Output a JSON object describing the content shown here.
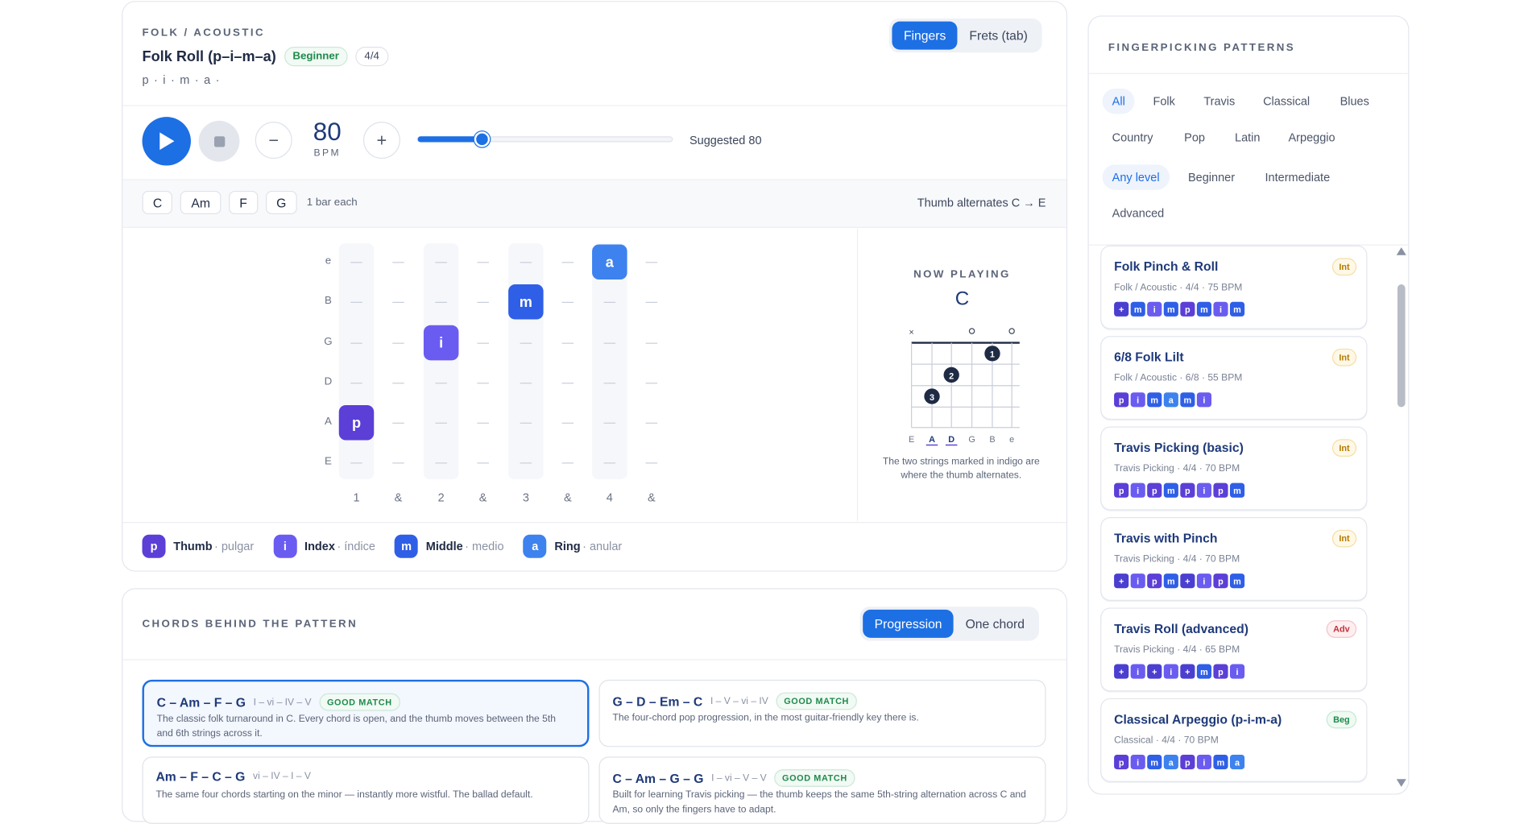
{
  "pattern": {
    "genre": "FOLK / ACOUSTIC",
    "name": "Folk Roll (p–i–m–a)",
    "level": "Beginner",
    "meter": "4/4",
    "sequence": "p · i · m · a ·",
    "view_toggle": [
      "Fingers",
      "Frets (tab)"
    ],
    "view_selected": "Fingers"
  },
  "transport": {
    "bpm": "80",
    "bpm_unit": "BPM",
    "tempo_slider": {
      "min": 40,
      "max": 200,
      "value": 80
    },
    "suggested": "Suggested 80",
    "minus": "−",
    "plus": "+"
  },
  "chords": {
    "items": [
      "C",
      "Am",
      "F",
      "G"
    ],
    "duration": "1 bar each",
    "note": "Thumb alternates C → E"
  },
  "grid": {
    "strings": [
      "e",
      "B",
      "G",
      "D",
      "A",
      "E"
    ],
    "beats": [
      "1",
      "&",
      "2",
      "&",
      "3",
      "&",
      "4",
      "&"
    ],
    "notes": [
      {
        "step": 1,
        "string": "A",
        "finger": "p"
      },
      {
        "step": 3,
        "string": "G",
        "finger": "i"
      },
      {
        "step": 5,
        "string": "B",
        "finger": "m"
      },
      {
        "step": 7,
        "string": "e",
        "finger": "a"
      }
    ]
  },
  "now_playing": {
    "label": "NOW PLAYING",
    "chord": "C",
    "markers": [
      "×",
      "",
      "",
      "○",
      "",
      "○"
    ],
    "dots": [
      "1",
      "2",
      "3"
    ],
    "string_labels": [
      "E",
      "A",
      "D",
      "G",
      "B",
      "e"
    ],
    "caption": "The two strings marked in indigo are where the thumb alternates."
  },
  "legend": [
    {
      "key": "p",
      "name": "Thumb",
      "alt": "· pulgar"
    },
    {
      "key": "i",
      "name": "Index",
      "alt": "· índice"
    },
    {
      "key": "m",
      "name": "Middle",
      "alt": "· medio"
    },
    {
      "key": "a",
      "name": "Ring",
      "alt": "· anular"
    }
  ],
  "colors": {
    "p": "#5b3fd6",
    "i": "#6a5cf0",
    "m": "#2f5fe6",
    "a": "#3d82ee",
    "accent": "#1d6fe4"
  },
  "progressions": {
    "title": "CHORDS BEHIND THE PATTERN",
    "toggle": [
      "Progression",
      "One chord"
    ],
    "items": [
      {
        "chords": "C – Am – F – G",
        "roman": "I – vi – IV – V",
        "badge": "GOOD MATCH",
        "desc": "The classic folk turnaround in C. Every chord is open, and the thumb moves between the 5th and 6th strings across it."
      },
      {
        "chords": "G – D – Em – C",
        "roman": "I – V – vi – IV",
        "badge": "GOOD MATCH",
        "desc": "The four-chord pop progression, in the most guitar-friendly key there is."
      },
      {
        "chords": "Am – F – C – G",
        "roman": "vi – IV – I – V",
        "badge": "",
        "desc": "The same four chords starting on the minor — instantly more wistful. The ballad default."
      },
      {
        "chords": "C – Am – G – G",
        "roman": "I – vi – V – V",
        "badge": "GOOD MATCH",
        "desc": "Built for learning Travis picking — the thumb keeps the same 5th-string alternation across C and Am, so only the fingers have to adapt."
      }
    ]
  },
  "sidebar": {
    "title": "FINGERPICKING PATTERNS",
    "styles": [
      "All",
      "Folk",
      "Travis",
      "Classical",
      "Blues",
      "Country",
      "Pop",
      "Latin",
      "Arpeggio"
    ],
    "levels": [
      "Any level",
      "Beginner",
      "Intermediate",
      "Advanced"
    ],
    "patterns": [
      {
        "name": "Folk Pinch & Roll",
        "meta": "Folk / Acoustic · 4/4 · 75 BPM",
        "level": "Int",
        "tokens": [
          "+",
          "m",
          "i",
          "m",
          "p",
          "m",
          "i",
          "m"
        ]
      },
      {
        "name": "6/8 Folk Lilt",
        "meta": "Folk / Acoustic · 6/8 · 55 BPM",
        "level": "Int",
        "tokens": [
          "p",
          "i",
          "m",
          "a",
          "m",
          "i"
        ]
      },
      {
        "name": "Travis Picking (basic)",
        "meta": "Travis Picking · 4/4 · 70 BPM",
        "level": "Int",
        "tokens": [
          "p",
          "i",
          "p",
          "m",
          "p",
          "i",
          "p",
          "m"
        ]
      },
      {
        "name": "Travis with Pinch",
        "meta": "Travis Picking · 4/4 · 70 BPM",
        "level": "Int",
        "tokens": [
          "+",
          "i",
          "p",
          "m",
          "+",
          "i",
          "p",
          "m"
        ]
      },
      {
        "name": "Travis Roll (advanced)",
        "meta": "Travis Picking · 4/4 · 65 BPM",
        "level": "Adv",
        "tokens": [
          "+",
          "i",
          "+",
          "i",
          "+",
          "m",
          "p",
          "i"
        ]
      },
      {
        "name": "Classical Arpeggio (p-i-m-a)",
        "meta": "Classical · 4/4 · 70 BPM",
        "level": "Beg",
        "tokens": [
          "p",
          "i",
          "m",
          "a",
          "p",
          "i",
          "m",
          "a"
        ]
      }
    ]
  }
}
